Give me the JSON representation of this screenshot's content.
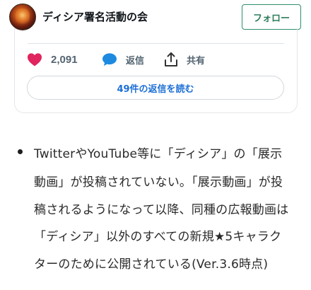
{
  "header": {
    "account_name": "ディシア署名活動の会",
    "follow_label": "フォロー"
  },
  "actions": {
    "like_count": "2,091",
    "reply_label": "返信",
    "share_label": "共有"
  },
  "replies_button": "49件の返信を読む",
  "article": {
    "lines": [
      "TwitterやYouTube等に「ディシア」の「展示",
      "動画」が投稿されていない。「展示動画」が投",
      "稿されるようになって以降、同種の広報動画は",
      "「ディシア」以外のすべての新規★5キャラク",
      "ターのために公開されている(Ver.3.6時点)"
    ]
  },
  "colors": {
    "like": "#e0245e",
    "reply": "#1d8ae0",
    "follow_border": "#2e8f6a",
    "link": "#1d6fd6"
  }
}
